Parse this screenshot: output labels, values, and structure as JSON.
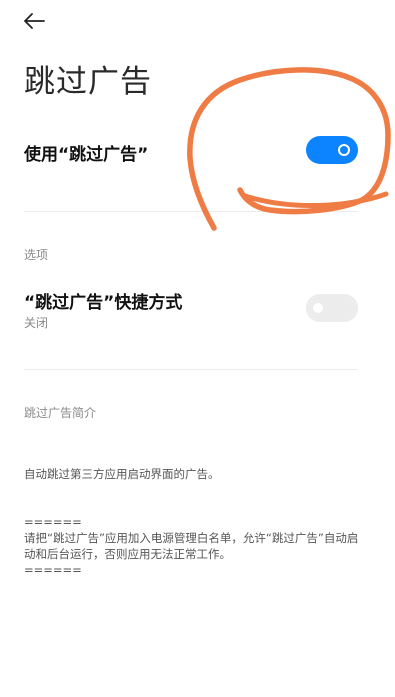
{
  "header": {
    "back_icon": "arrow-left-icon",
    "title": "跳过广告"
  },
  "main_setting": {
    "label": "使用“跳过广告”",
    "enabled": true,
    "toggle_color": "#0d84ff"
  },
  "options_section": {
    "label": "选项",
    "shortcut": {
      "label": "“跳过广告”快捷方式",
      "status": "关闭",
      "enabled": false
    }
  },
  "intro_section": {
    "label": "跳过广告简介",
    "line1": "自动跳过第三方应用启动界面的广告。",
    "separator_top": "======",
    "line2": "请把“跳过广告”应用加入电源管理白名单，允许“跳过广告”自动启动和后台运行，否则应用无法正常工作。",
    "separator_bottom": "======"
  },
  "annotation": {
    "shape": "hand-drawn-circle",
    "color": "#f07c45"
  }
}
